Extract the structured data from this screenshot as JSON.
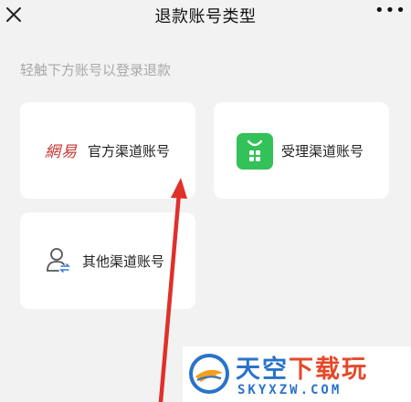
{
  "header": {
    "title": "退款账号类型",
    "close_icon": "close-icon",
    "more_icon": "more-icon",
    "more_label": "•••"
  },
  "hint": "轻触下方账号以登录退款",
  "accounts": [
    {
      "logo_text": "網易",
      "label": "官方渠道账号",
      "icon": "netease-logo"
    },
    {
      "label": "受理渠道账号",
      "icon": "green-app-icon"
    },
    {
      "label": "其他渠道账号",
      "icon": "person-exchange-icon"
    }
  ],
  "colors": {
    "background": "#f2f2f2",
    "card": "#ffffff",
    "netease_red": "#c8332d",
    "green_icon": "#33c15a",
    "arrow_red": "#e0302a",
    "watermark_blue": "#2a73c9",
    "watermark_orange": "#e44a2a"
  },
  "watermark": {
    "title_main": "天空",
    "title_accent": "下载玩",
    "domain": "SKYXZW.COM"
  }
}
